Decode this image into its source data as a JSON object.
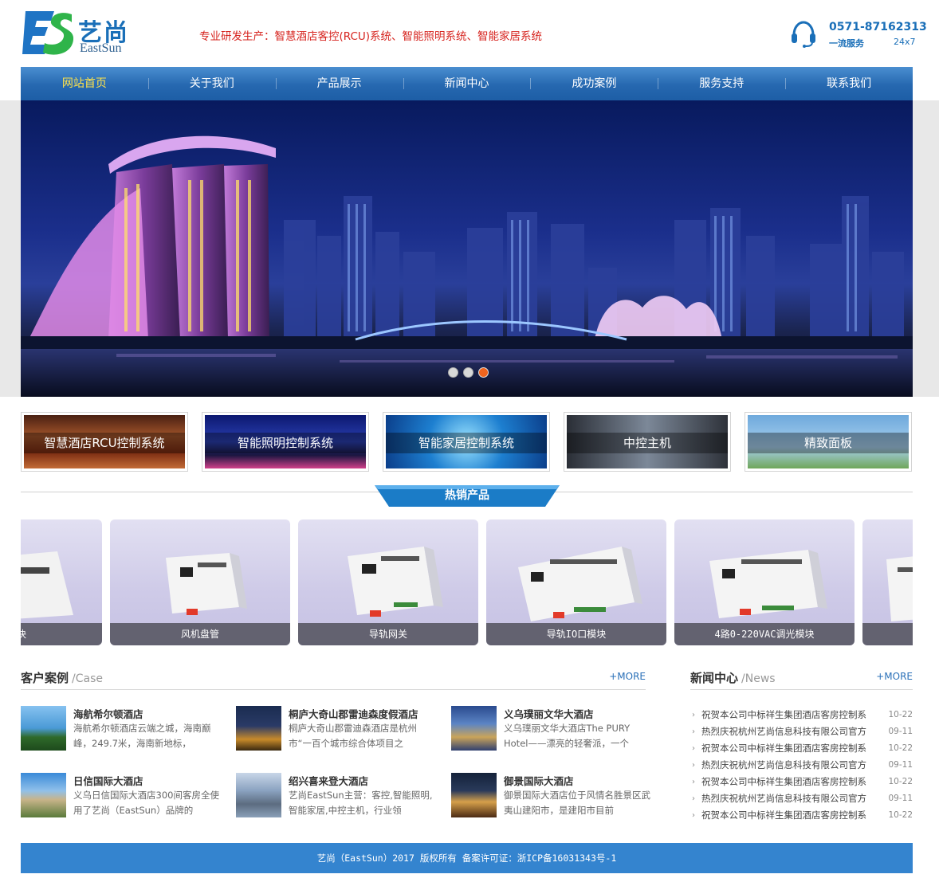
{
  "header": {
    "logo_cn": "艺尚",
    "logo_en": "EastSun",
    "slogan": "专业研发生产：智慧酒店客控(RCU)系统、智能照明系统、智能家居系统",
    "phone": "0571-87162313",
    "service_label": "一流服务",
    "service_hours": "24x7"
  },
  "nav": [
    {
      "label": "网站首页",
      "active": true
    },
    {
      "label": "关于我们"
    },
    {
      "label": "产品展示"
    },
    {
      "label": "新闻中心"
    },
    {
      "label": "成功案例"
    },
    {
      "label": "服务支持"
    },
    {
      "label": "联系我们"
    }
  ],
  "banner": {
    "slides": 3,
    "active_slide": 3
  },
  "categories": [
    {
      "label": "智慧酒店RCU控制系统"
    },
    {
      "label": "智能照明控制系统"
    },
    {
      "label": "智能家居控制系统"
    },
    {
      "label": "中控主机"
    },
    {
      "label": "精致面板"
    }
  ],
  "hot": {
    "title": "热销产品"
  },
  "products": [
    {
      "label": "移模块"
    },
    {
      "label": "风机盘管"
    },
    {
      "label": "导轨网关"
    },
    {
      "label": "导轨IO口模块"
    },
    {
      "label": "4路0-220VAC调光模块"
    },
    {
      "label": ""
    }
  ],
  "cases": {
    "title": "客户案例",
    "subtitle": "/Case",
    "more": "+MORE",
    "items": [
      {
        "title": "海航希尔顿酒店",
        "desc": "海航希尔顿酒店云端之城，海南巅峰，249.7米，海南新地标，"
      },
      {
        "title": "桐庐大奇山郡雷迪森度假酒店",
        "desc": "桐庐大奇山郡雷迪森酒店是杭州市“一百个城市综合体项目之"
      },
      {
        "title": "义乌璞丽文华大酒店",
        "desc": "义乌璞丽文华大酒店The PURY Hotel——漂亮的轻奢派，一个"
      },
      {
        "title": "日信国际大酒店",
        "desc": "义乌日信国际大酒店300间客房全使用了艺尚（EastSun）品牌的"
      },
      {
        "title": "绍兴喜来登大酒店",
        "desc": "艺尚EastSun主营：客控,智能照明,智能家居,中控主机，行业领"
      },
      {
        "title": "御景国际大酒店",
        "desc": "御景国际大酒店位于风情名胜景区武夷山建阳市，是建阳市目前"
      }
    ]
  },
  "news": {
    "title": "新闻中心",
    "subtitle": "/News",
    "more": "+MORE",
    "items": [
      {
        "title": "祝贺本公司中标祥生集团酒店客房控制系",
        "date": "10-22"
      },
      {
        "title": "热烈庆祝杭州艺尚信息科技有限公司官方",
        "date": "09-11"
      },
      {
        "title": "祝贺本公司中标祥生集团酒店客房控制系",
        "date": "10-22"
      },
      {
        "title": "热烈庆祝杭州艺尚信息科技有限公司官方",
        "date": "09-11"
      },
      {
        "title": "祝贺本公司中标祥生集团酒店客房控制系",
        "date": "10-22"
      },
      {
        "title": "热烈庆祝杭州艺尚信息科技有限公司官方",
        "date": "09-11"
      },
      {
        "title": "祝贺本公司中标祥生集团酒店客房控制系",
        "date": "10-22"
      }
    ]
  },
  "footer": {
    "text": "艺尚（EastSun）2017 版权所有 备案许可证：浙ICP备16031343号-1"
  },
  "colors": {
    "brand_blue": "#1a6fb8",
    "nav_active": "#ffe34a",
    "slogan_red": "#d6231e",
    "footer_blue": "#3484cf",
    "dot_active": "#f0641e"
  }
}
